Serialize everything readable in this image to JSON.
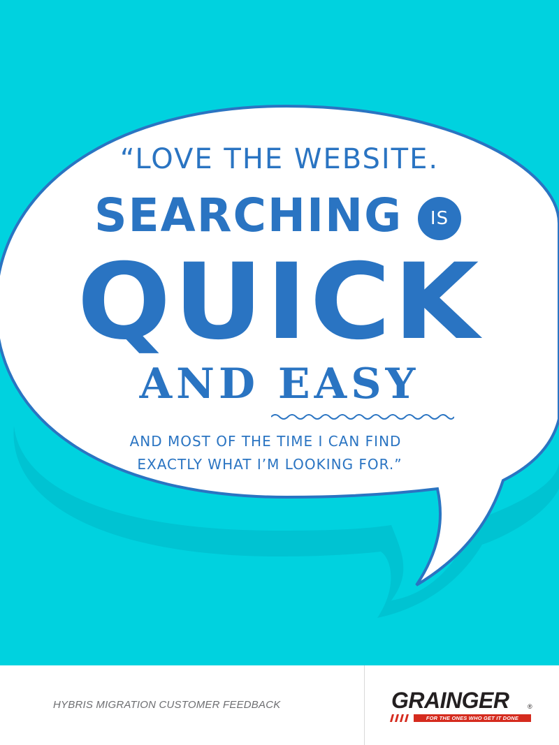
{
  "poster": {
    "background_color": "#00d2df",
    "bubble_fill": "#ffffff",
    "bubble_outline": "#2a74c2",
    "text_color": "#2a74c2",
    "quote": {
      "line1": "“LOVE THE WEBSITE.",
      "line2": "SEARCHING",
      "line2_badge": "IS",
      "line3": "QUICK",
      "line4": "AND EASY",
      "line5": "AND MOST OF THE TIME I CAN FIND",
      "line6": "EXACTLY WHAT I’M LOOKING FOR.”"
    }
  },
  "footer": {
    "caption": "HYBRIS MIGRATION CUSTOMER FEEDBACK",
    "logo": {
      "wordmark": "GRAINGER",
      "registered": "®",
      "tagline": "FOR THE ONES WHO GET IT DONE",
      "tagline_color": "#d52b1e"
    }
  }
}
